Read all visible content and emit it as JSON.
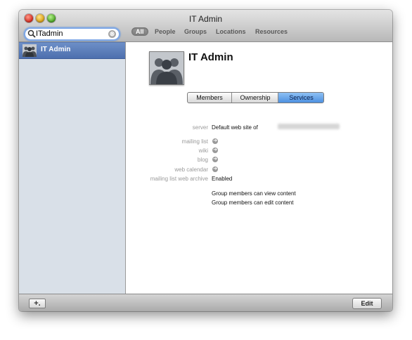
{
  "window": {
    "title": "IT Admin"
  },
  "search": {
    "value": "ITadmin",
    "clear_glyph": "⊗"
  },
  "filters": [
    {
      "label": "All",
      "active": true
    },
    {
      "label": "People"
    },
    {
      "label": "Groups"
    },
    {
      "label": "Locations"
    },
    {
      "label": "Resources"
    }
  ],
  "sidebar": {
    "items": [
      {
        "label": "IT Admin",
        "icon": "group-icon",
        "selected": true
      }
    ]
  },
  "detail": {
    "title": "IT Admin",
    "tabs": [
      {
        "label": "Members"
      },
      {
        "label": "Ownership"
      },
      {
        "label": "Services",
        "selected": true
      }
    ],
    "fields": {
      "server": {
        "label": "server",
        "value": "Default web site of"
      },
      "mailing_list": {
        "label": "mailing list"
      },
      "wiki": {
        "label": "wiki"
      },
      "blog": {
        "label": "blog"
      },
      "web_calendar": {
        "label": "web calendar"
      },
      "mailing_list_web_archive": {
        "label": "mailing list web archive",
        "value": "Enabled"
      }
    },
    "permissions": [
      "Group members can view content",
      "Group members can edit content"
    ]
  },
  "bottombar": {
    "add_label": "+.",
    "edit_label": "Edit"
  },
  "colors": {
    "selection": "#4d6fae",
    "tab_selected": "#4d90e0"
  }
}
